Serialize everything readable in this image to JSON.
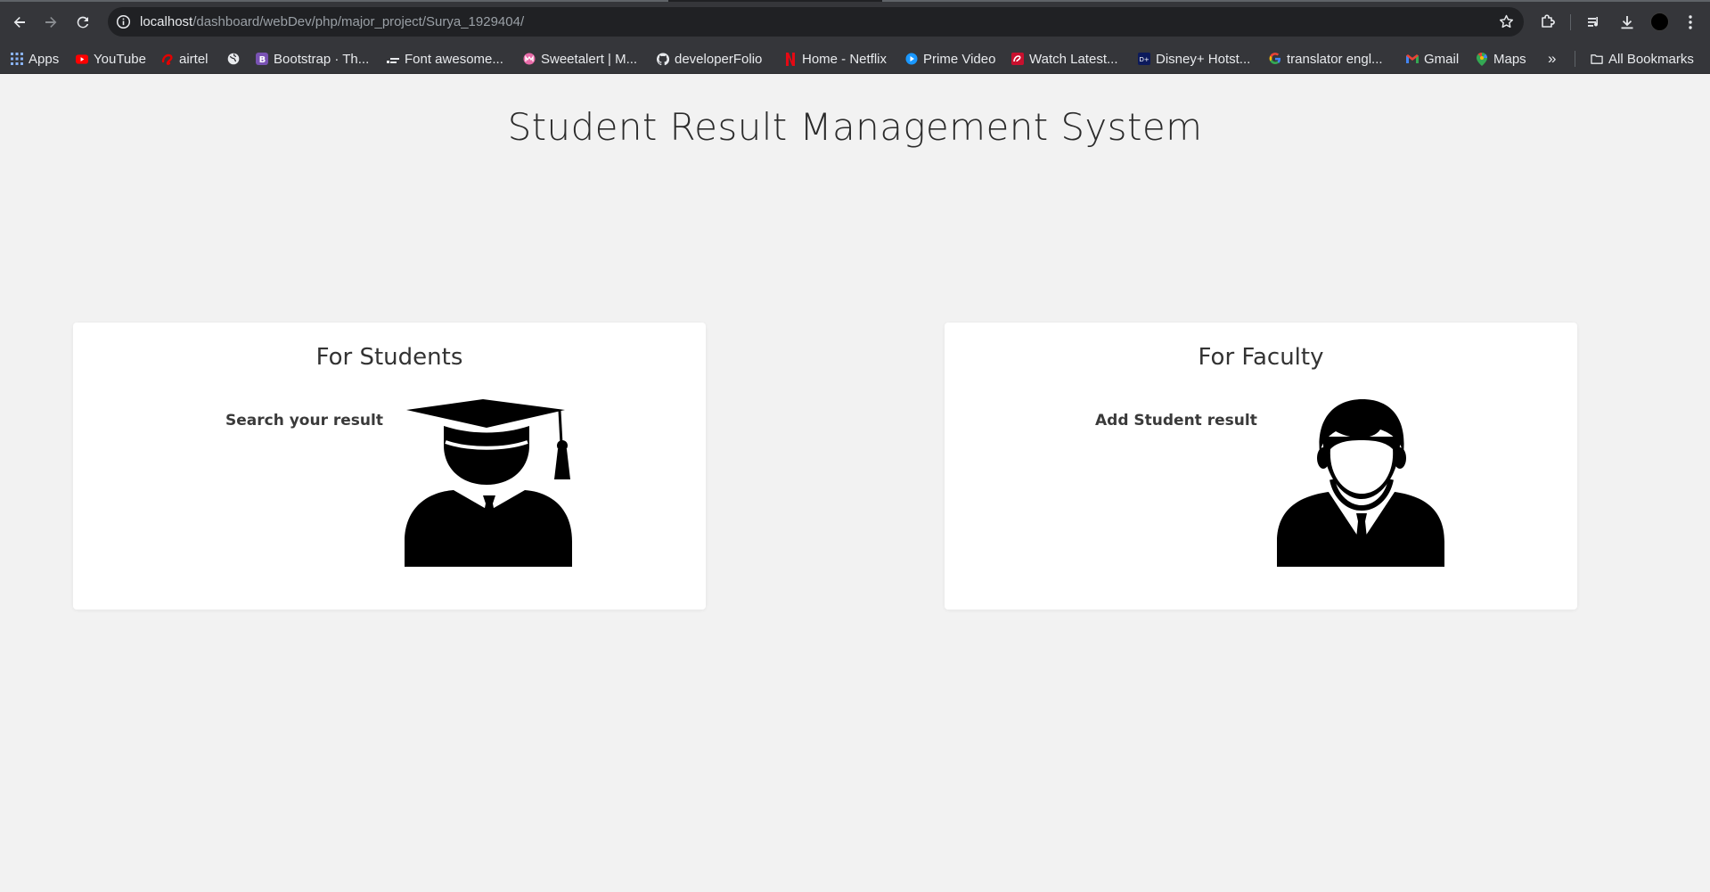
{
  "browser": {
    "url_host": "localhost",
    "url_path": "/dashboard/webDev/php/major_project/Surya_1929404/",
    "icons": [
      "back-arrow-icon",
      "forward-arrow-icon",
      "reload-icon",
      "site-info-icon",
      "bookmark-star-icon",
      "extensions-icon",
      "media-controls-icon",
      "download-icon",
      "profile-avatar-icon",
      "menu-kebab-icon"
    ]
  },
  "bookmarks": {
    "items": [
      {
        "label": "Apps",
        "icon": "apps-grid-icon"
      },
      {
        "label": "YouTube",
        "icon": "youtube-icon"
      },
      {
        "label": "airtel",
        "icon": "airtel-icon"
      },
      {
        "label": "",
        "icon": "globe-icon"
      },
      {
        "label": "Bootstrap · Th...",
        "icon": "bootstrap-icon"
      },
      {
        "label": "Font awesome...",
        "icon": "font-awesome-icon"
      },
      {
        "label": "Sweetalert | M...",
        "icon": "sweetalert-icon"
      },
      {
        "label": "developerFolio",
        "icon": "github-icon"
      },
      {
        "label": "Home - Netflix",
        "icon": "netflix-icon"
      },
      {
        "label": "Prime Video",
        "icon": "prime-video-icon"
      },
      {
        "label": "Watch Latest...",
        "icon": "airtel-xstream-icon"
      },
      {
        "label": "Disney+ Hotst...",
        "icon": "hotstar-icon"
      },
      {
        "label": "translator engl...",
        "icon": "google-icon"
      },
      {
        "label": "Gmail",
        "icon": "gmail-icon"
      },
      {
        "label": "Maps",
        "icon": "maps-icon"
      }
    ],
    "overflow": "»",
    "all_bookmarks": "All Bookmarks"
  },
  "page": {
    "title": "Student Result Management System",
    "students": {
      "heading": "For Students",
      "link": "Search your result",
      "icon": "graduate-icon"
    },
    "faculty": {
      "heading": "For Faculty",
      "link": "Add Student result",
      "icon": "faculty-person-icon"
    }
  },
  "colors": {
    "background": "#f2f2f2",
    "card": "#ffffff",
    "chrome": "#35363a",
    "omnibox": "#202124",
    "text": "#2b2b2b"
  }
}
